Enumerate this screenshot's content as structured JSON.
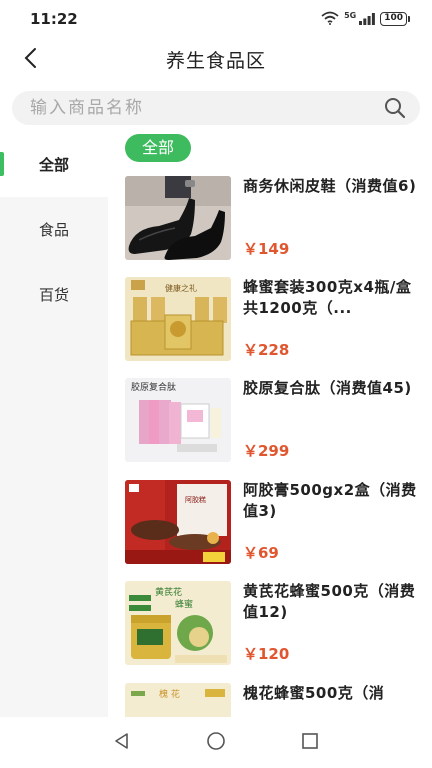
{
  "status": {
    "time": "11:22",
    "network": "5G",
    "battery": "100"
  },
  "header": {
    "title": "养生食品区"
  },
  "search": {
    "placeholder": "输入商品名称"
  },
  "sidebar": {
    "items": [
      {
        "label": "全部"
      },
      {
        "label": "食品"
      },
      {
        "label": "百货"
      }
    ]
  },
  "filter": {
    "label": "全部"
  },
  "products": [
    {
      "name": "商务休闲皮鞋（消费值6)",
      "price": "￥149"
    },
    {
      "name": "蜂蜜套装300克x4瓶/盒共1200克（...",
      "price": "￥228"
    },
    {
      "name": "胶原复合肽（消费值45)",
      "price": "￥299"
    },
    {
      "name": "阿胶膏500gx2盒（消费值3)",
      "price": "￥69"
    },
    {
      "name": "黄芪花蜂蜜500克（消费值12)",
      "price": "￥120"
    },
    {
      "name": "槐花蜂蜜500克（消",
      "price": ""
    }
  ],
  "thumb_text": {
    "honey_set": "健康之礼",
    "collagen": "胶原复合肽",
    "ejiao": "阿胶糕",
    "huangqi": "黄芪花",
    "huangqi_sub": "蜂蜜",
    "huai": "槐 花"
  },
  "colors": {
    "accent": "#3dbb5e",
    "price": "#e0562f",
    "sidebar_bg": "#f6f6f6"
  }
}
